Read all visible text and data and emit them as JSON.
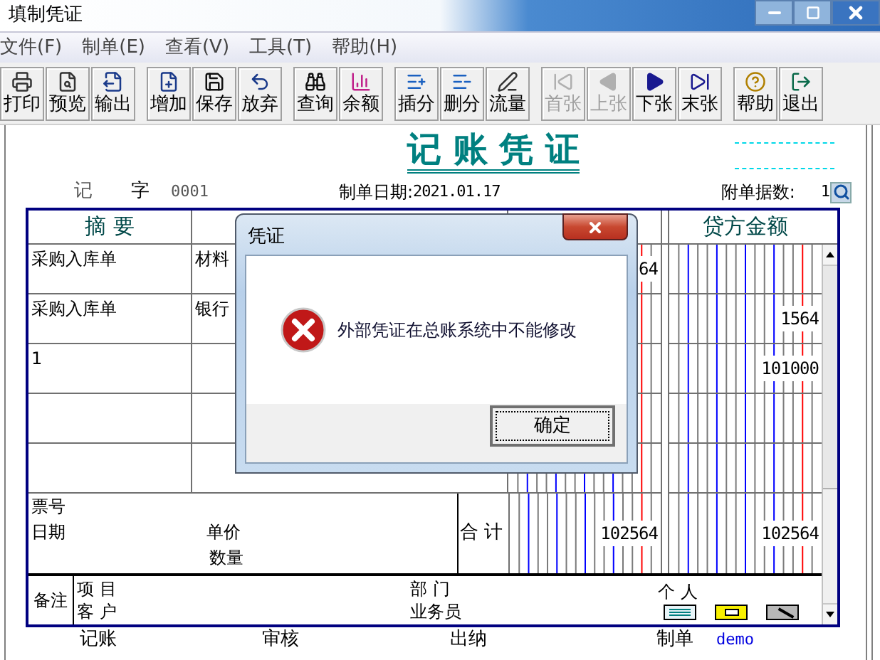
{
  "window": {
    "title": "填制凭证"
  },
  "menu": [
    {
      "label": "文件(F)"
    },
    {
      "label": "制单(E)"
    },
    {
      "label": "查看(V)"
    },
    {
      "label": "工具(T)"
    },
    {
      "label": "帮助(H)"
    }
  ],
  "toolbar": [
    [
      {
        "label": "打印",
        "disabled": false
      },
      {
        "label": "预览",
        "disabled": false
      },
      {
        "label": "输出",
        "disabled": false
      }
    ],
    [
      {
        "label": "增加",
        "disabled": false
      },
      {
        "label": "保存",
        "disabled": false
      },
      {
        "label": "放弃",
        "disabled": false
      }
    ],
    [
      {
        "label": "查询",
        "disabled": false
      },
      {
        "label": "余额",
        "disabled": false
      }
    ],
    [
      {
        "label": "插分",
        "disabled": false
      },
      {
        "label": "删分",
        "disabled": false
      },
      {
        "label": "流量",
        "disabled": false
      }
    ],
    [
      {
        "label": "首张",
        "disabled": true
      },
      {
        "label": "上张",
        "disabled": true
      },
      {
        "label": "下张",
        "disabled": false
      },
      {
        "label": "末张",
        "disabled": false
      }
    ],
    [
      {
        "label": "帮助",
        "disabled": false
      },
      {
        "label": "退出",
        "disabled": false
      }
    ]
  ],
  "voucher": {
    "title": "记 账 凭 证",
    "type": "记",
    "word": "字",
    "number": "0001",
    "date_label": "制单日期:",
    "date": "2021.01.17",
    "attachments_label": "附单据数:",
    "attachments": "1",
    "summary_header": "摘 要",
    "credit_header": "贷方金额",
    "rows": [
      {
        "summary": "采购入库单",
        "account": "材料",
        "debit": "64"
      },
      {
        "summary": "采购入库单",
        "account": "银行",
        "credit": "1564"
      },
      {
        "summary": "1",
        "credit": "101000"
      }
    ],
    "ticket_label": "票号",
    "date_field_label": "日期",
    "price_label": "单价",
    "quantity_label": "数量",
    "total_label": "合 计",
    "total_debit": "102564",
    "total_credit": "102564",
    "notes_label": "备注",
    "project_label": "项 目",
    "customer_label": "客 户",
    "department_label": "部 门",
    "salesperson_label": "业务员",
    "person_label": "个 人",
    "signatures": [
      {
        "label": "记账"
      },
      {
        "label": "审核"
      },
      {
        "label": "出纳"
      },
      {
        "label": "制单",
        "value": "demo"
      }
    ]
  },
  "dialog": {
    "title": "凭证",
    "message": "外部凭证在总账系统中不能修改",
    "button": "确定"
  }
}
